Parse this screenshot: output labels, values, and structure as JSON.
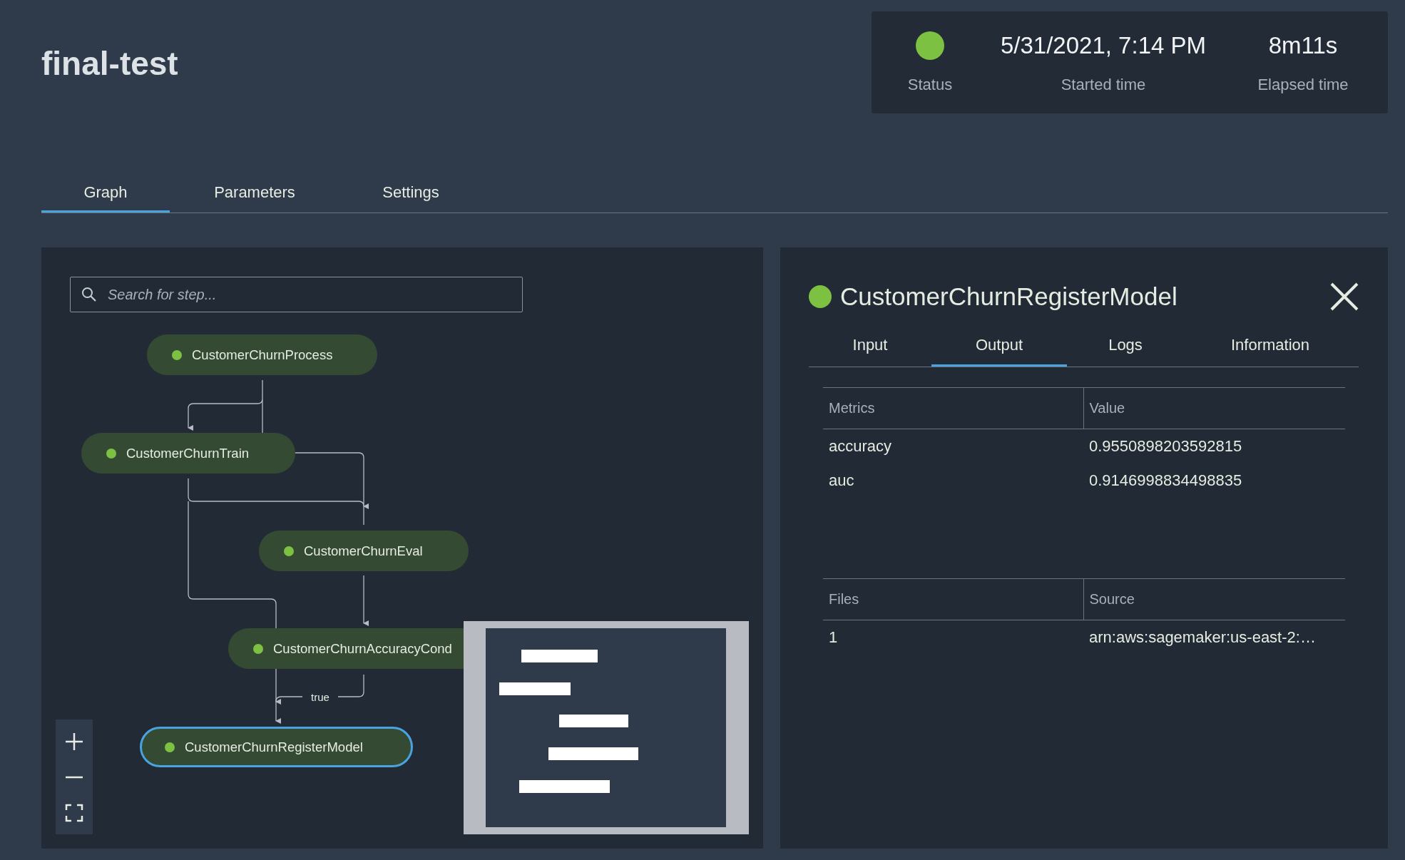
{
  "pipeline": {
    "title": "final-test"
  },
  "summary": {
    "status": {
      "color": "#7dc142",
      "label": "Status"
    },
    "started": {
      "value": "5/31/2021, 7:14 PM",
      "label": "Started time"
    },
    "elapsed": {
      "value": "8m11s",
      "label": "Elapsed time"
    }
  },
  "tabs": [
    {
      "label": "Graph",
      "selected": true
    },
    {
      "label": "Parameters",
      "selected": false
    },
    {
      "label": "Settings",
      "selected": false
    }
  ],
  "graph": {
    "search": {
      "placeholder": "Search for step..."
    },
    "nodes": [
      {
        "name": "CustomerChurnProcess",
        "color": "#7dc142",
        "selected": false
      },
      {
        "name": "CustomerChurnTrain",
        "color": "#7dc142",
        "selected": false
      },
      {
        "name": "CustomerChurnEval",
        "color": "#7dc142",
        "selected": false
      },
      {
        "name": "CustomerChurnAccuracyCond",
        "color": "#7dc142",
        "selected": false
      },
      {
        "name": "CustomerChurnRegisterModel",
        "color": "#7dc142",
        "selected": true
      }
    ],
    "condition_label": "true"
  },
  "detail": {
    "title": "CustomerChurnRegisterModel",
    "color": "#7dc142",
    "tabs": [
      {
        "label": "Input",
        "selected": false
      },
      {
        "label": "Output",
        "selected": true
      },
      {
        "label": "Logs",
        "selected": false
      },
      {
        "label": "Information",
        "selected": false
      }
    ],
    "metrics": {
      "columns": [
        "Metrics",
        "Value"
      ],
      "rows": [
        [
          "accuracy",
          "0.9550898203592815"
        ],
        [
          "auc",
          "0.9146998834498835"
        ]
      ]
    },
    "files": {
      "columns": [
        "Files",
        "Source"
      ],
      "rows": [
        [
          "1",
          "arn:aws:sagemaker:us-east-2:…"
        ]
      ]
    }
  }
}
